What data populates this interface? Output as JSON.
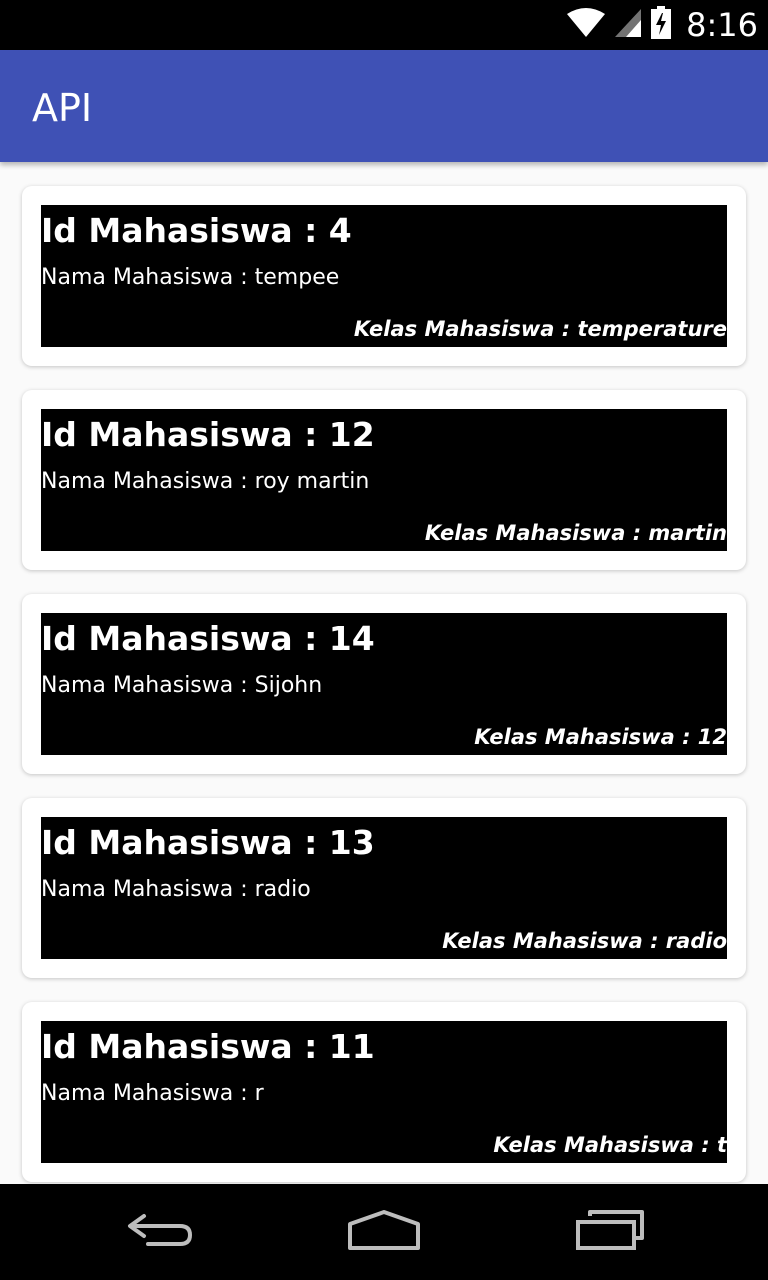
{
  "status_bar": {
    "time": "8:16",
    "icons": [
      "wifi-icon",
      "cell-signal-icon",
      "battery-charging-icon"
    ]
  },
  "app_bar": {
    "title": "API",
    "color": "#3f51b5"
  },
  "cards": [
    {
      "id": "Id Mahasiswa : 4",
      "nama": "Nama Mahasiswa : tempee",
      "kelas": "Kelas Mahasiswa : temperature"
    },
    {
      "id": "Id Mahasiswa : 12",
      "nama": "Nama Mahasiswa : roy martin",
      "kelas": "Kelas Mahasiswa : martin"
    },
    {
      "id": "Id Mahasiswa : 14",
      "nama": "Nama Mahasiswa : Sijohn",
      "kelas": "Kelas Mahasiswa : 12"
    },
    {
      "id": "Id Mahasiswa : 13",
      "nama": "Nama Mahasiswa : radio",
      "kelas": "Kelas Mahasiswa : radio"
    },
    {
      "id": "Id Mahasiswa : 11",
      "nama": "Nama Mahasiswa : r",
      "kelas": "Kelas Mahasiswa : t"
    }
  ],
  "nav_bar": {
    "icons": [
      "back-icon",
      "home-icon",
      "recents-icon"
    ]
  }
}
